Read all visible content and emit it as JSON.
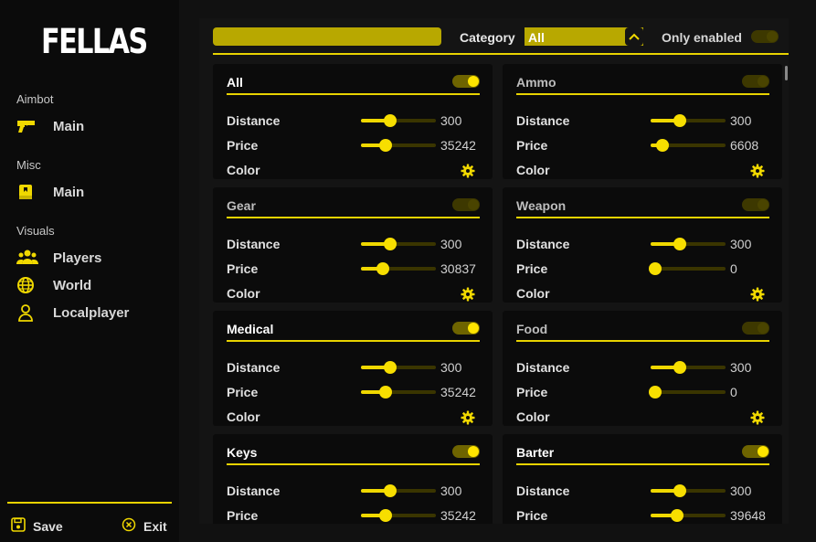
{
  "app": {
    "logo": "FELLAS"
  },
  "sidebar": {
    "sections": [
      {
        "label": "Aimbot",
        "items": [
          {
            "label": "Main",
            "icon": "gun-icon"
          }
        ]
      },
      {
        "label": "Misc",
        "items": [
          {
            "label": "Main",
            "icon": "book-icon"
          }
        ]
      },
      {
        "label": "Visuals",
        "items": [
          {
            "label": "Players",
            "icon": "users-icon"
          },
          {
            "label": "World",
            "icon": "globe-icon"
          },
          {
            "label": "Localplayer",
            "icon": "user-icon"
          }
        ]
      }
    ],
    "save_label": "Save",
    "exit_label": "Exit"
  },
  "toolbar": {
    "search_value": "",
    "category_label": "Category",
    "category_value": "All",
    "only_enabled_label": "Only enabled",
    "only_enabled": false
  },
  "row_labels": {
    "distance": "Distance",
    "price": "Price",
    "color": "Color"
  },
  "cards": [
    {
      "title": "All",
      "enabled": true,
      "distance": "300",
      "distance_pct": 0.35,
      "price": "35242",
      "price_pct": 0.29,
      "has_color": true
    },
    {
      "title": "Ammo",
      "enabled": false,
      "distance": "300",
      "distance_pct": 0.35,
      "price": "6608",
      "price_pct": 0.12,
      "has_color": true
    },
    {
      "title": "Gear",
      "enabled": false,
      "distance": "300",
      "distance_pct": 0.35,
      "price": "30837",
      "price_pct": 0.26,
      "has_color": true
    },
    {
      "title": "Weapon",
      "enabled": false,
      "distance": "300",
      "distance_pct": 0.35,
      "price": "0",
      "price_pct": 0.0,
      "has_color": true
    },
    {
      "title": "Medical",
      "enabled": true,
      "distance": "300",
      "distance_pct": 0.35,
      "price": "35242",
      "price_pct": 0.29,
      "has_color": true
    },
    {
      "title": "Food",
      "enabled": false,
      "distance": "300",
      "distance_pct": 0.35,
      "price": "0",
      "price_pct": 0.0,
      "has_color": true
    },
    {
      "title": "Keys",
      "enabled": true,
      "distance": "300",
      "distance_pct": 0.35,
      "price": "35242",
      "price_pct": 0.29,
      "has_color": false
    },
    {
      "title": "Barter",
      "enabled": true,
      "distance": "300",
      "distance_pct": 0.35,
      "price": "39648",
      "price_pct": 0.32,
      "has_color": false
    }
  ],
  "colors": {
    "accent": "#e8d300",
    "knob": "#f7de00",
    "card_bg": "#0b0b0b",
    "panel_bg": "#141414",
    "title_on": "#ffffff",
    "title_off": "#bdbdbd"
  }
}
